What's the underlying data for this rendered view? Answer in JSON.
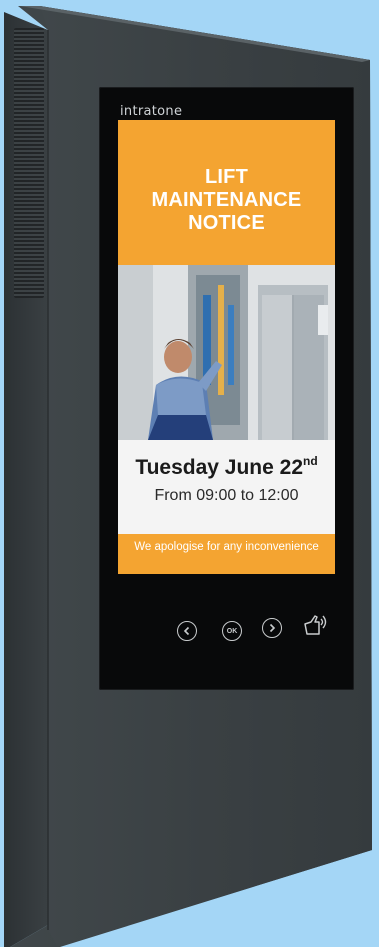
{
  "device": {
    "brand": "intratone",
    "colors": {
      "background": "#a4d6f6",
      "body": "#3b4144",
      "accent": "#f4a431",
      "screen": "#08090a"
    }
  },
  "notice": {
    "title_lines": [
      "LIFT",
      "MAINTENANCE",
      "NOTICE"
    ],
    "date_main": "Tuesday June 22",
    "date_suffix": "nd",
    "time": "From 09:00 to 12:00",
    "apology": "We apologise for any inconvenience"
  },
  "controls": {
    "prev_icon": "chevron-left-icon",
    "ok_label": "OK",
    "next_icon": "chevron-right-icon",
    "audio_icon": "hand-audio-icon"
  }
}
